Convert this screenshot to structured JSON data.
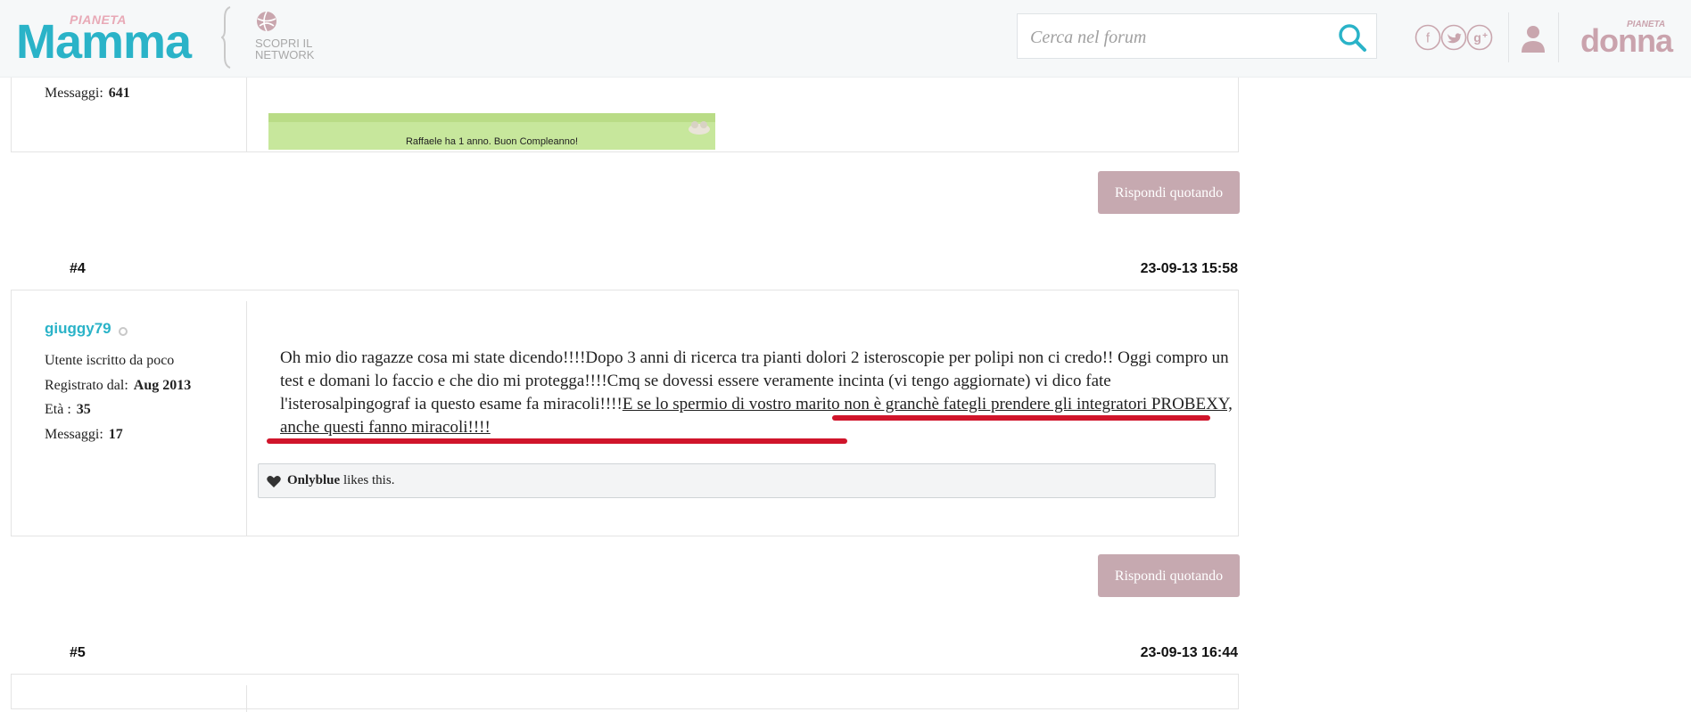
{
  "header": {
    "logo_pianeta": "PIANETA",
    "logo_mamma": "Mamma",
    "network_label": "SCOPRI IL NETWORK",
    "search_placeholder": "Cerca nel forum",
    "donna_pianeta": "PIANETA",
    "donna_word": "donna",
    "icons": [
      "search-icon",
      "facebook-icon",
      "twitter-icon",
      "google-plus-icon",
      "user-icon",
      "globe-icon"
    ]
  },
  "prev_post": {
    "messages_label": "Messaggi:",
    "messages_value": "641",
    "signature_text": "Raffaele ha 1 anno. Buon Compleanno!",
    "reply_label": "Rispondi quotando"
  },
  "post4": {
    "number": "#4",
    "date": "23-09-13 15:58",
    "username": "giuggy79",
    "rank": "Utente iscritto da poco",
    "registered_label": "Registrato dal:",
    "registered_value": "Aug 2013",
    "age_label": "Età :",
    "age_value": "35",
    "messages_label": "Messaggi:",
    "messages_value": "17",
    "text_plain": "Oh mio dio ragazze cosa mi state dicendo!!!!Dopo 3 anni di ricerca tra pianti dolori 2 isteroscopie per polipi non ci credo!! Oggi compro un test e domani lo faccio e che dio mi protegga!!!!Cmq se dovessi essere veramente incinta (vi tengo aggiornate) vi dico fate l'isterosalpingograf ia questo esame fa miracoli!!!!",
    "text_marked": "E se lo spermio di vostro marito non è granchè fategli prendere gli integratori PROBEXY, anche questi fanno miracoli!!!!",
    "likes_user": "Onlyblue",
    "likes_suffix": " likes this.",
    "reply_label": "Rispondi quotando"
  },
  "post5": {
    "number": "#5",
    "date": "23-09-13 16:44"
  },
  "colors": {
    "brand_teal": "#2ab3c8",
    "reply_button": "#c6a9b0",
    "annotation_red": "#d0152b"
  }
}
